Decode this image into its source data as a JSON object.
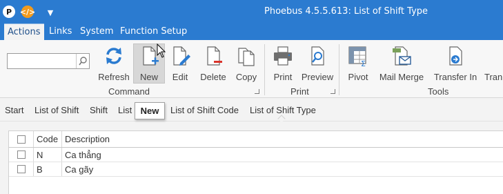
{
  "titlebar": {
    "logo_icon": "phoebus-logo-icon",
    "code_icon": "code-icon",
    "dropdown_glyph": "▼",
    "title": "Phoebus 4.5.5.613: List of Shift Type"
  },
  "menu": {
    "items": [
      "Actions",
      "Links",
      "System",
      "Function Setup"
    ],
    "active": "Actions"
  },
  "search": {
    "value": "",
    "placeholder": ""
  },
  "ribbon": {
    "command": {
      "label": "Command",
      "buttons": [
        {
          "label": "Refresh",
          "icon": "refresh-icon"
        },
        {
          "label": "New",
          "icon": "new-document-icon"
        },
        {
          "label": "Edit",
          "icon": "edit-icon"
        },
        {
          "label": "Delete",
          "icon": "delete-icon"
        },
        {
          "label": "Copy",
          "icon": "copy-icon"
        }
      ]
    },
    "print": {
      "label": "Print",
      "buttons": [
        {
          "label": "Print",
          "icon": "printer-icon"
        },
        {
          "label": "Preview",
          "icon": "preview-icon"
        }
      ]
    },
    "tools": {
      "label": "Tools",
      "buttons": [
        {
          "label": "Pivot",
          "icon": "pivot-icon"
        },
        {
          "label": "Mail Merge",
          "icon": "mail-merge-icon"
        },
        {
          "label": "Transfer In",
          "icon": "transfer-in-icon"
        },
        {
          "label": "Tran",
          "icon": "transfer-out-icon"
        }
      ]
    }
  },
  "breadcrumb": [
    "Start",
    "List of Shift",
    "Shift",
    "List",
    "List of Shift Code",
    "List of Shift Type"
  ],
  "tooltip": "New",
  "grid": {
    "columns": [
      "Code",
      "Description"
    ],
    "rows": [
      {
        "code": "N",
        "description": "Ca thẳng"
      },
      {
        "code": "B",
        "description": "Ca gãy"
      }
    ]
  },
  "colors": {
    "title_blue": "#2b7bd0",
    "ribbon_bg": "#f7f7f7",
    "accent_red": "#d9342b",
    "accent_blue": "#2b7bd0"
  }
}
